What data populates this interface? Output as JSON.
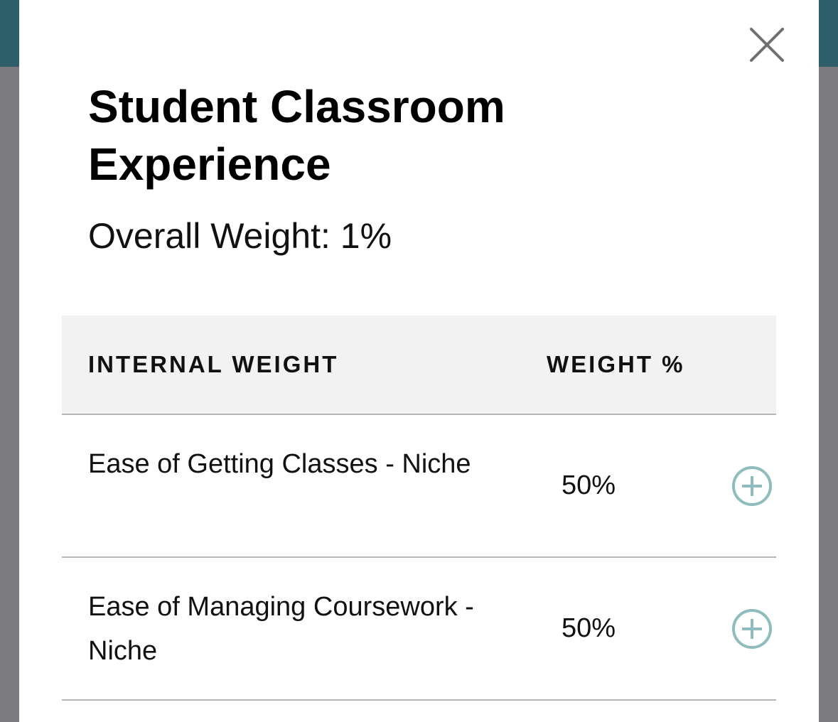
{
  "modal": {
    "title": "Student Classroom Experience",
    "overall_weight": "Overall Weight: 1%",
    "close_icon": "close-icon"
  },
  "table": {
    "headers": {
      "name": "INTERNAL WEIGHT",
      "weight": "WEIGHT %"
    },
    "rows": [
      {
        "name": "Ease of Getting Classes - Niche",
        "weight": "50%",
        "icon": "plus-circle-icon"
      },
      {
        "name": "Ease of Managing Coursework - Niche",
        "weight": "50%",
        "icon": "plus-circle-icon"
      }
    ]
  },
  "colors": {
    "header_bar": "#2e5f69",
    "overlay": "#7b7b80",
    "accent_icon": "#8fbcbc",
    "close_icon": "#6f6f6f"
  }
}
